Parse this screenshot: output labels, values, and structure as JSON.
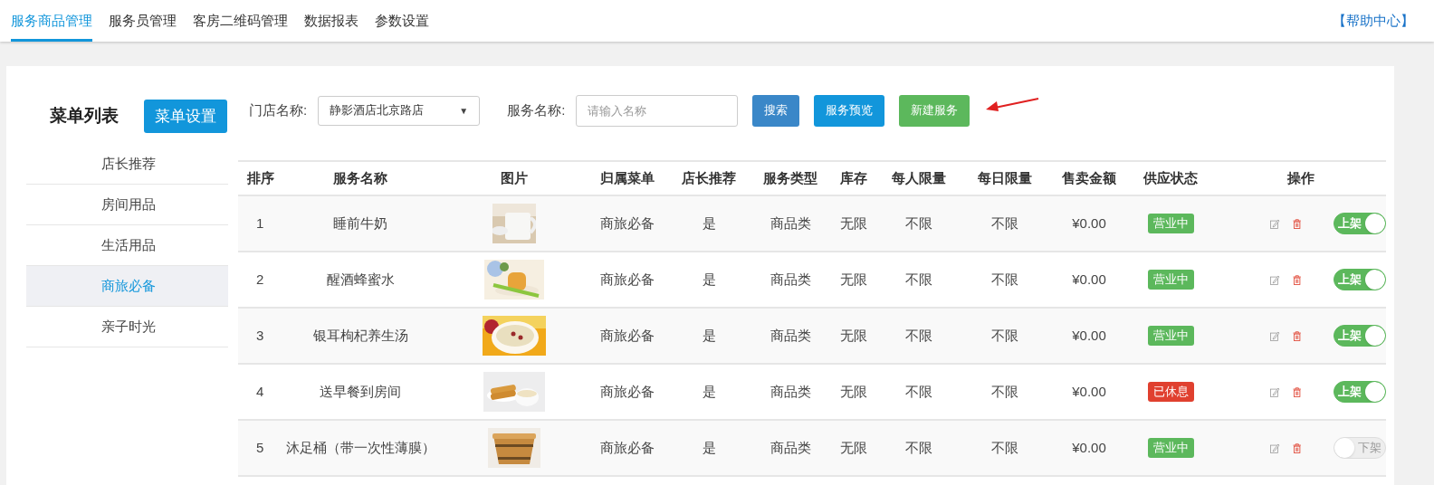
{
  "nav": {
    "tabs": [
      {
        "label": "服务商品管理",
        "selected": true
      },
      {
        "label": "服务员管理",
        "selected": false
      },
      {
        "label": "客房二维码管理",
        "selected": false
      },
      {
        "label": "数据报表",
        "selected": false
      },
      {
        "label": "参数设置",
        "selected": false
      }
    ],
    "help": "【帮助中心】"
  },
  "sidebar": {
    "title": "菜单列表",
    "settings_button": "菜单设置",
    "items": [
      {
        "label": "店长推荐",
        "selected": false
      },
      {
        "label": "房间用品",
        "selected": false
      },
      {
        "label": "生活用品",
        "selected": false
      },
      {
        "label": "商旅必备",
        "selected": true
      },
      {
        "label": "亲子时光",
        "selected": false
      }
    ]
  },
  "filters": {
    "store_label": "门店名称:",
    "store_value": "静影酒店北京路店",
    "store_caret": "▼",
    "service_label": "服务名称:",
    "service_placeholder": "请输入名称",
    "buttons": [
      {
        "label": "搜索",
        "kind": "blue"
      },
      {
        "label": "服务预览",
        "kind": "sky"
      },
      {
        "label": "新建服务",
        "kind": "green"
      }
    ]
  },
  "table": {
    "columns": [
      "排序",
      "服务名称",
      "图片",
      "归属菜单",
      "店长推荐",
      "服务类型",
      "库存",
      "每人限量",
      "每日限量",
      "售卖金额",
      "供应状态",
      "操作"
    ],
    "rows": [
      {
        "order": "1",
        "name": "睡前牛奶",
        "menu": "商旅必备",
        "recommended": "是",
        "type": "商品类",
        "stock": "无限",
        "per_person": "不限",
        "per_day": "不限",
        "price": "¥0.00",
        "status": {
          "label": "营业中",
          "kind": "open"
        },
        "shelf": {
          "label": "上架",
          "on": true
        }
      },
      {
        "order": "2",
        "name": "醒酒蜂蜜水",
        "menu": "商旅必备",
        "recommended": "是",
        "type": "商品类",
        "stock": "无限",
        "per_person": "不限",
        "per_day": "不限",
        "price": "¥0.00",
        "status": {
          "label": "营业中",
          "kind": "open"
        },
        "shelf": {
          "label": "上架",
          "on": true
        }
      },
      {
        "order": "3",
        "name": "银耳枸杞养生汤",
        "menu": "商旅必备",
        "recommended": "是",
        "type": "商品类",
        "stock": "无限",
        "per_person": "不限",
        "per_day": "不限",
        "price": "¥0.00",
        "status": {
          "label": "营业中",
          "kind": "open"
        },
        "shelf": {
          "label": "上架",
          "on": true
        }
      },
      {
        "order": "4",
        "name": "送早餐到房间",
        "menu": "商旅必备",
        "recommended": "是",
        "type": "商品类",
        "stock": "无限",
        "per_person": "不限",
        "per_day": "不限",
        "price": "¥0.00",
        "status": {
          "label": "已休息",
          "kind": "closed"
        },
        "shelf": {
          "label": "上架",
          "on": true
        }
      },
      {
        "order": "5",
        "name": "沐足桶（带一次性薄膜）",
        "menu": "商旅必备",
        "recommended": "是",
        "type": "商品类",
        "stock": "无限",
        "per_person": "不限",
        "per_day": "不限",
        "price": "¥0.00",
        "status": {
          "label": "营业中",
          "kind": "open"
        },
        "shelf": {
          "label": "下架",
          "on": false
        }
      }
    ]
  }
}
